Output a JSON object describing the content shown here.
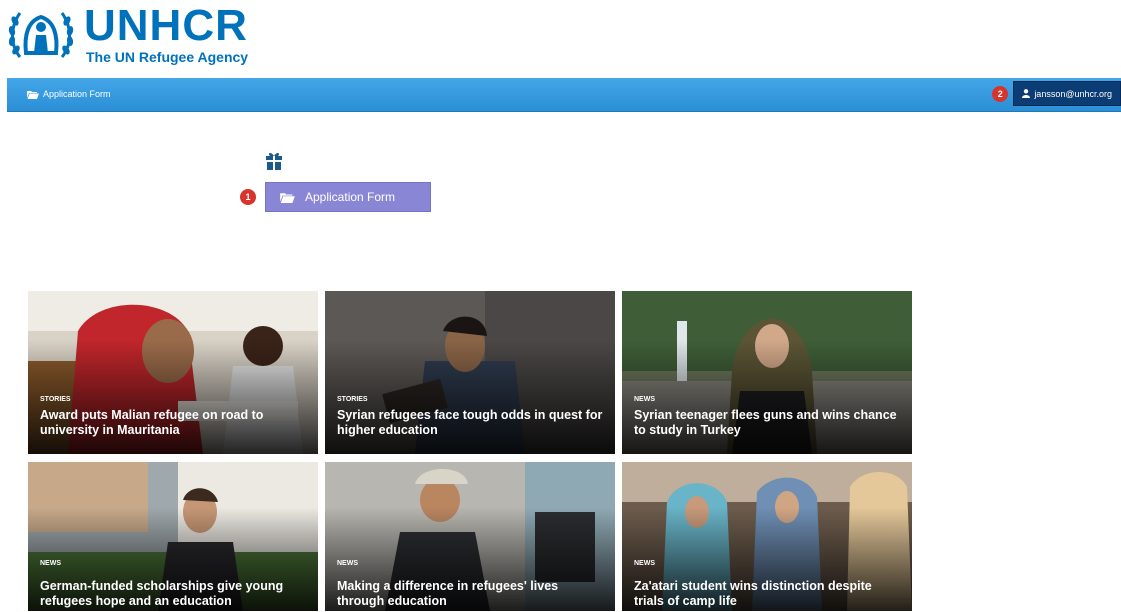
{
  "logo": {
    "title": "UNHCR",
    "subtitle": "The UN Refugee Agency"
  },
  "navbar": {
    "left_label": "Application Form",
    "badge": "2",
    "user": "jansson@unhcr.org"
  },
  "main": {
    "badge": "1",
    "app_button_label": "Application Form"
  },
  "cards": [
    {
      "tag": "STORIES",
      "title": "Award puts Malian refugee on road to university in Mauritania"
    },
    {
      "tag": "STORIES",
      "title": "Syrian refugees face tough odds in quest for higher education"
    },
    {
      "tag": "NEWS",
      "title": "Syrian teenager flees guns and wins chance to study in Turkey"
    },
    {
      "tag": "NEWS",
      "title": "German-funded scholarships give young refugees hope and an education"
    },
    {
      "tag": "NEWS",
      "title": "Making a difference in refugees' lives through education"
    },
    {
      "tag": "NEWS",
      "title": "Za'atari student wins distinction despite trials of camp life"
    }
  ],
  "colors": {
    "brand_blue": "#0072bc",
    "navbar": "#3399dd",
    "user_button": "#0b3c73",
    "badge_red": "#d6342c",
    "app_button": "#8a86d6"
  },
  "icons": {
    "nav_folder": "folder-open-icon",
    "user": "user-icon",
    "gift": "gift-icon",
    "app_folder": "folder-open-icon"
  }
}
